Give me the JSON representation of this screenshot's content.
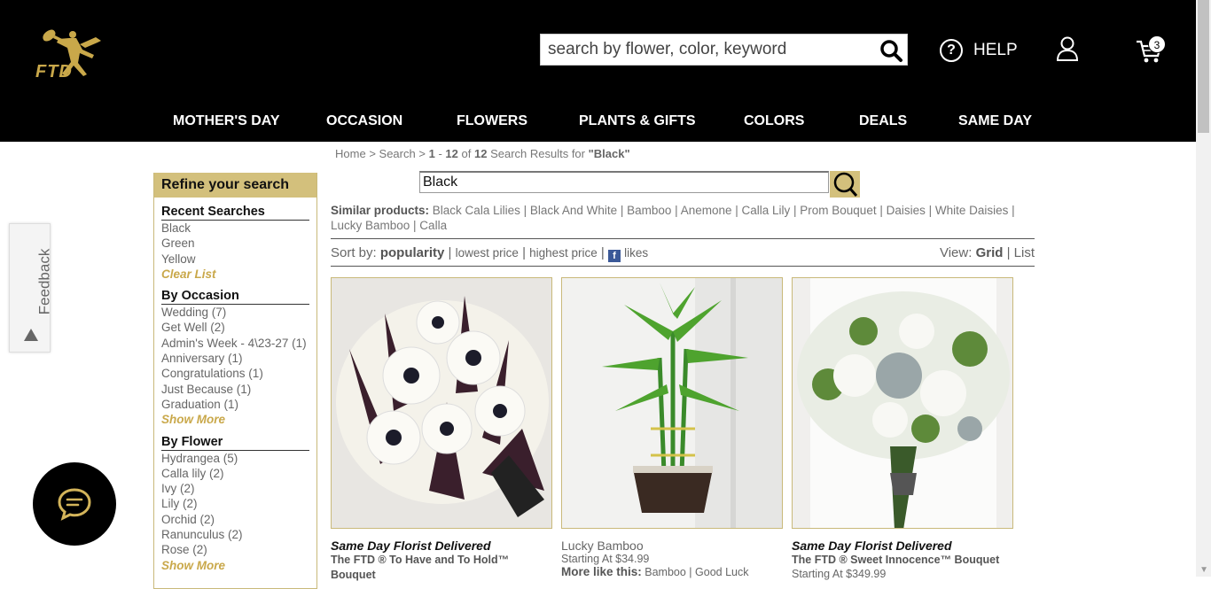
{
  "header": {
    "logo_text": "FTD",
    "search_placeholder": "search by flower, color, keyword",
    "help_label": "HELP",
    "cart_count": "3"
  },
  "nav": [
    "MOTHER'S DAY",
    "OCCASION",
    "FLOWERS",
    "PLANTS & GIFTS",
    "COLORS",
    "DEALS",
    "SAME DAY"
  ],
  "breadcrumb": {
    "home": "Home",
    "sep1": ">",
    "search": "Search",
    "sep2": ">",
    "range": "1",
    "dash": "-",
    "range_end": "12",
    "of": "of",
    "total": "12",
    "results_for": "Search Results for",
    "query": "\"Black\""
  },
  "sidebar": {
    "title": "Refine your search",
    "recent": {
      "heading": "Recent Searches",
      "items": [
        "Black",
        "Green",
        "Yellow"
      ],
      "clear": "Clear List"
    },
    "occasion": {
      "heading": "By Occasion",
      "items": [
        "Wedding (7)",
        "Get Well (2)",
        "Admin's Week - 4\\23-27 (1)",
        "Anniversary (1)",
        "Congratulations (1)",
        "Just Because (1)",
        "Graduation (1)"
      ],
      "more": "Show More"
    },
    "flower": {
      "heading": "By Flower",
      "items": [
        "Hydrangea (5)",
        "Calla lily (2)",
        "Ivy (2)",
        "Lily (2)",
        "Orchid (2)",
        "Ranunculus (2)",
        "Rose (2)"
      ],
      "more": "Show More"
    }
  },
  "feedback_label": "Feedback",
  "search_query": "Black",
  "similar": {
    "label": "Similar products:",
    "items_text": "Black Cala Lilies | Black And White | Bamboo | Anemone | Calla Lily | Prom Bouquet | Daisies | White Daisies | Lucky Bamboo | Calla"
  },
  "sort": {
    "label": "Sort by:",
    "popularity": "popularity",
    "lowest": "lowest price",
    "highest": "highest price",
    "likes": "likes",
    "sep": "|"
  },
  "view": {
    "label": "View:",
    "grid": "Grid",
    "sep": "|",
    "list": "List"
  },
  "products": [
    {
      "tag": "Same Day Florist Delivered",
      "name": "The FTD ® To Have and To Hold™ Bouquet",
      "price": ""
    },
    {
      "tag": "",
      "name": "Lucky Bamboo",
      "price": "Starting At $34.99",
      "more_label": "More like this:",
      "more_links": "Bamboo | Good Luck"
    },
    {
      "tag": "Same Day Florist Delivered",
      "name": "The FTD ® Sweet Innocence™ Bouquet",
      "price": "Starting At $349.99"
    }
  ],
  "colors": {
    "header_bg": "#000000",
    "gold": "#c9a84a",
    "sidebar_head": "#d3c07c"
  }
}
